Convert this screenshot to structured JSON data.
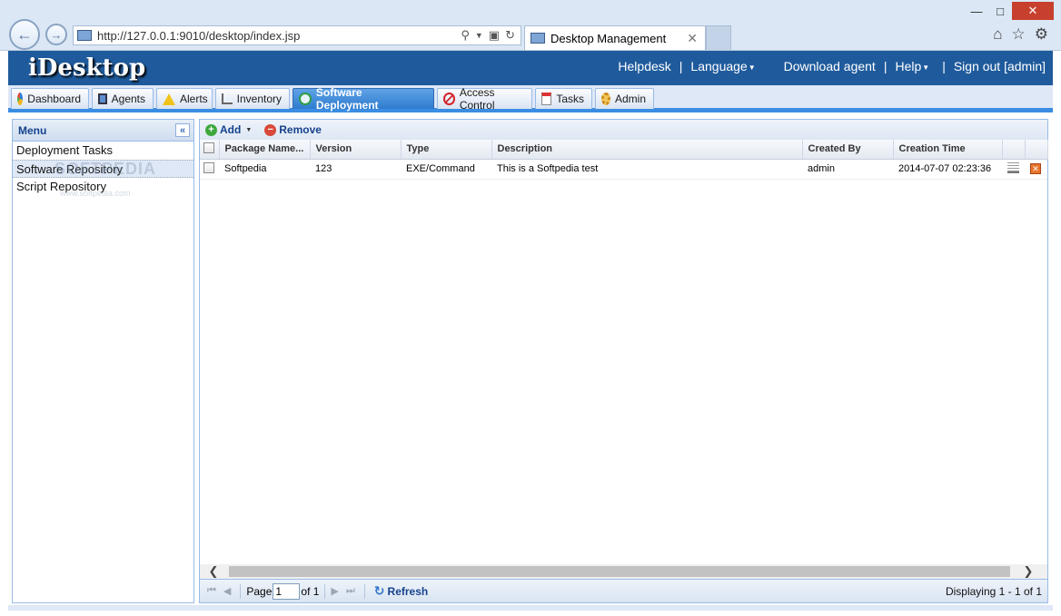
{
  "browser": {
    "url": "http://127.0.0.1:9010/desktop/index.jsp",
    "tab_title": "Desktop Management",
    "tab_close": "✕"
  },
  "header": {
    "logo": "iDesktop",
    "links": {
      "helpdesk": "Helpdesk",
      "language": "Language",
      "download_agent": "Download agent",
      "help": "Help",
      "sign_out": "Sign out [admin]"
    },
    "separator": "|"
  },
  "modules": [
    {
      "label": "Dashboard",
      "icon": "pie-chart-icon"
    },
    {
      "label": "Agents",
      "icon": "monitor-icon"
    },
    {
      "label": "Alerts",
      "icon": "warning-icon"
    },
    {
      "label": "Inventory",
      "icon": "tree-icon"
    },
    {
      "label": "Software Deployment",
      "icon": "deploy-icon"
    },
    {
      "label": "Access Control",
      "icon": "no-entry-icon"
    },
    {
      "label": "Tasks",
      "icon": "calendar-icon"
    },
    {
      "label": "Admin",
      "icon": "gear-icon"
    }
  ],
  "active_module": "Software Deployment",
  "sidebar": {
    "title": "Menu",
    "collapse_label": "«",
    "items": [
      "Deployment Tasks",
      "Software Repository",
      "Script Repository"
    ],
    "selected": "Software Repository"
  },
  "watermark": {
    "text": "SOFTPEDIA",
    "sub": "www.softpedia.com"
  },
  "toolbar": {
    "add_label": "Add",
    "remove_label": "Remove"
  },
  "grid": {
    "columns": [
      "Package Name...",
      "Version",
      "Type",
      "Description",
      "Created By",
      "Creation Time"
    ],
    "rows": [
      {
        "package_name": "Softpedia",
        "version": "123",
        "type": "EXE/Command",
        "description": "This is a Softpedia test",
        "created_by": "admin",
        "creation_time": "2014-07-07 02:23:36"
      }
    ]
  },
  "pager": {
    "page_label": "Page",
    "page_value": "1",
    "of_label": "of 1",
    "refresh_label": "Refresh",
    "displaying": "Displaying 1 - 1 of 1"
  }
}
